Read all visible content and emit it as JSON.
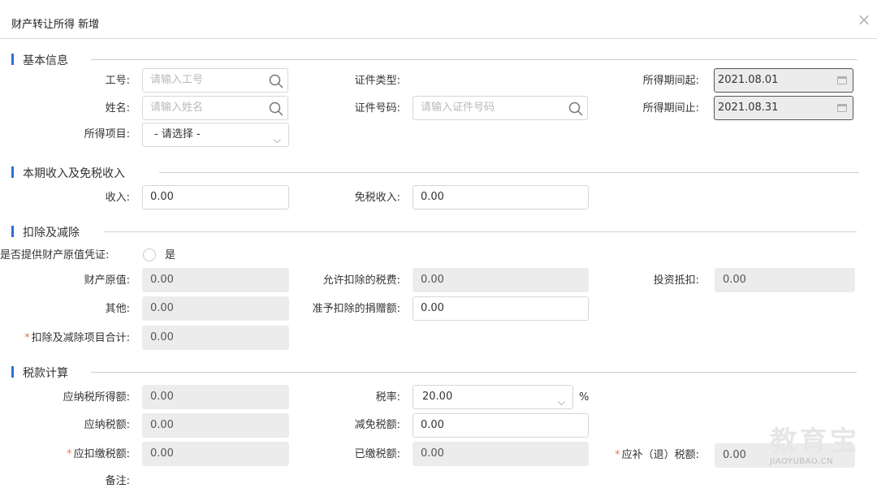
{
  "dialog": {
    "title": "财产转让所得 新增",
    "close_symbol": "×"
  },
  "sections": {
    "basic": "基本信息",
    "income": "本期收入及免税收入",
    "deduction": "扣除及减除",
    "tax": "税款计算"
  },
  "basic": {
    "job_no_label": "工号:",
    "job_no_placeholder": "请输入工号",
    "name_label": "姓名:",
    "name_placeholder": "请输入姓名",
    "item_label": "所得项目:",
    "item_value": "- 请选择 -",
    "id_type_label": "证件类型:",
    "id_no_label": "证件号码:",
    "id_no_placeholder": "请输入证件号码",
    "period_start_label": "所得期间起:",
    "period_start_value": "2021.08.01",
    "period_end_label": "所得期间止:",
    "period_end_value": "2021.08.31"
  },
  "income": {
    "income_label": "收入:",
    "income_value": "0.00",
    "exempt_label": "免税收入:",
    "exempt_value": "0.00"
  },
  "deduction": {
    "provide_label": "是否提供财产原值凭证:",
    "provide_option": "是",
    "original_label": "财产原值:",
    "original_value": "0.00",
    "allowed_tax_label": "允许扣除的税费:",
    "allowed_tax_value": "0.00",
    "invest_label": "投资抵扣:",
    "invest_value": "0.00",
    "other_label": "其他:",
    "other_value": "0.00",
    "donation_label": "准予扣除的捐赠额:",
    "donation_value": "0.00",
    "total_label": "扣除及减除项目合计:",
    "total_value": "0.00"
  },
  "tax": {
    "taxable_income_label": "应纳税所得额:",
    "taxable_income_value": "0.00",
    "rate_label": "税率:",
    "rate_value": "20.00",
    "rate_unit": "%",
    "payable_label": "应纳税额:",
    "payable_value": "0.00",
    "reduce_label": "减免税额:",
    "reduce_value": "0.00",
    "withhold_label": "应扣缴税额:",
    "withhold_value": "0.00",
    "paid_label": "已缴税额:",
    "paid_value": "0.00",
    "refund_label": "应补（退）税额:",
    "refund_value": "0.00",
    "remark_label": "备注:"
  },
  "watermark": {
    "text": "教育宝",
    "domain": "JIAOYUBAO.CN"
  },
  "colors": {
    "accent": "#2f6fd8",
    "required": "#f07c3b",
    "readonly_bg": "#ececec",
    "border": "#d7d7d7"
  },
  "icons": {
    "search": "search-icon",
    "calendar": "calendar-icon",
    "dropdown": "chevron-down-icon",
    "close": "close-icon"
  }
}
